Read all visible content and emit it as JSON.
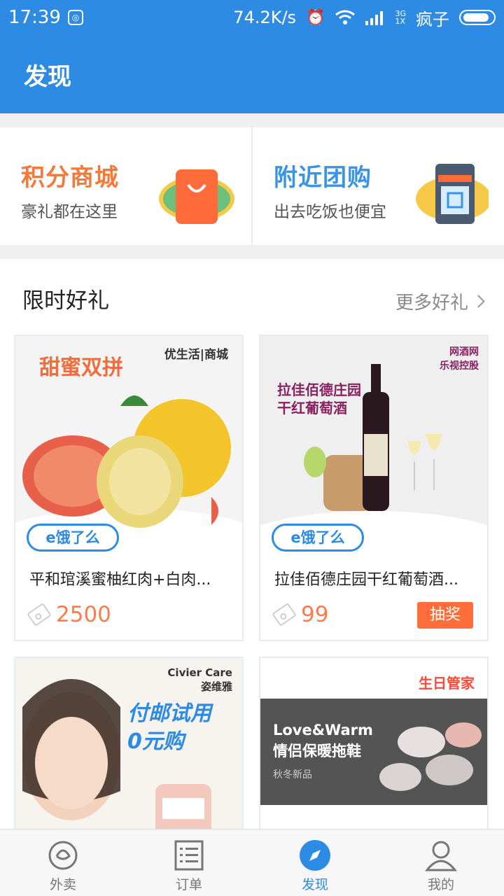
{
  "status_bar": {
    "time": "17:39",
    "speed": "74.2K/s",
    "network": "3G\n1X",
    "carrier": "疯子"
  },
  "app_bar": {
    "title": "发现"
  },
  "promos": [
    {
      "title": "积分商城",
      "subtitle": "豪礼都在这里",
      "title_color": "#f47a3c",
      "icon": "shopping-bag-icon"
    },
    {
      "title": "附近团购",
      "subtitle": "出去吃饭也便宜",
      "title_color": "#3a94e6",
      "icon": "storefront-icon"
    }
  ],
  "section": {
    "title": "限时好礼",
    "more_label": "更多好礼"
  },
  "products": [
    {
      "name": "平和琯溪蜜柚红肉+白肉...",
      "price": "2500",
      "image_headline": "甜蜜双拼",
      "brand": "优生活|商城",
      "badge": "e饿了么",
      "action": ""
    },
    {
      "name": "拉佳佰德庄园干红葡萄酒...",
      "price": "99",
      "image_headline": "拉佳佰德庄园\n干红葡萄酒",
      "brand": "网酒网\n乐视控股",
      "badge": "e饿了么",
      "action": "抽奖"
    },
    {
      "name": "",
      "price": "",
      "image_headline": "付邮试用\n0元购",
      "brand": "Civier Care\n姿维雅",
      "badge": "",
      "action": ""
    },
    {
      "name": "",
      "price": "",
      "image_headline": "Love&Warm\n情侣保暖拖鞋",
      "image_sub": "秋冬新品",
      "brand": "生日管家",
      "badge": "",
      "action": ""
    }
  ],
  "tabs": [
    {
      "label": "外卖",
      "icon": "eleme-logo-icon",
      "active": false
    },
    {
      "label": "订单",
      "icon": "order-list-icon",
      "active": false
    },
    {
      "label": "发现",
      "icon": "compass-icon",
      "active": true
    },
    {
      "label": "我的",
      "icon": "user-icon",
      "active": false
    }
  ],
  "colors": {
    "primary": "#2d8be3",
    "price": "#ff7b4c",
    "lottery": "#ff6d3b"
  }
}
